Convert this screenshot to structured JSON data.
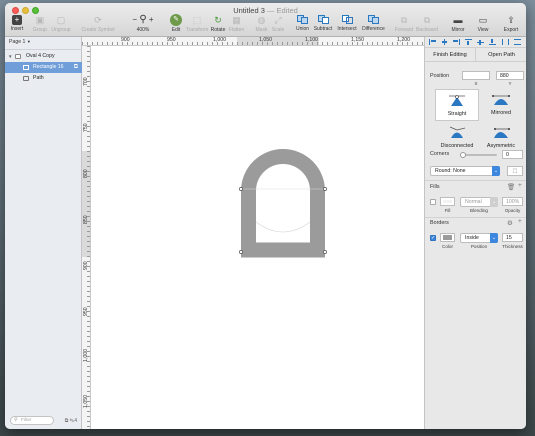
{
  "window": {
    "title": "Untitled 3",
    "status": " — Edited"
  },
  "toolbar": {
    "insert": "Insert",
    "group": "Group",
    "ungroup": "Ungroup",
    "create_symbol": "Create Symbol",
    "zoom_minus": "−",
    "zoom_plus": "+",
    "zoom_value": "400%",
    "edit": "Edit",
    "transform": "Transform",
    "rotate": "Rotate",
    "flatten": "Flatten",
    "mask": "Mask",
    "scale": "Scale",
    "union": "Union",
    "subtract": "Subtract",
    "intersect": "Intersect",
    "difference": "Difference",
    "forward": "Forward",
    "backward": "Backward",
    "mirror": "Mirror",
    "view": "View",
    "export": "Export"
  },
  "layers": {
    "page": "Page 1",
    "items": [
      {
        "name": "Oval 4 Copy"
      },
      {
        "name": "Rectangle 16"
      },
      {
        "name": "Path"
      }
    ],
    "filter_placeholder": "Filter",
    "filter_count": "4"
  },
  "ruler": {
    "top": [
      "900",
      "950",
      "1,000",
      "1,050",
      "1,100",
      "1,150",
      "1,200"
    ],
    "left": [
      "700",
      "750",
      "800",
      "850",
      "900",
      "950",
      "1,000",
      "1,050"
    ]
  },
  "inspector": {
    "finish_editing": "Finish Editing",
    "open_path": "Open Path",
    "position_label": "Position",
    "x_value": "",
    "y_value": "880",
    "x_label": "X",
    "y_label": "Y",
    "point_types": [
      "Straight",
      "Mirrored",
      "Disconnected",
      "Asymmetric"
    ],
    "corners_label": "Corners",
    "corners_value": "0",
    "corner_style": "Round: None",
    "fills_label": "Fills",
    "fill_blending": "Normal",
    "fill_opacity": "100%",
    "fill_labels": [
      "Fill",
      "Blending",
      "Opacity"
    ],
    "borders_label": "Borders",
    "border_position": "Inside",
    "border_thickness": "15",
    "border_labels": [
      "Color",
      "Position",
      "Thickness"
    ]
  },
  "colors": {
    "accent": "#3d87de",
    "selection": "#6f9ed8",
    "shape_stroke": "#9b9b9b",
    "edit_green": "#6e9a4a"
  }
}
